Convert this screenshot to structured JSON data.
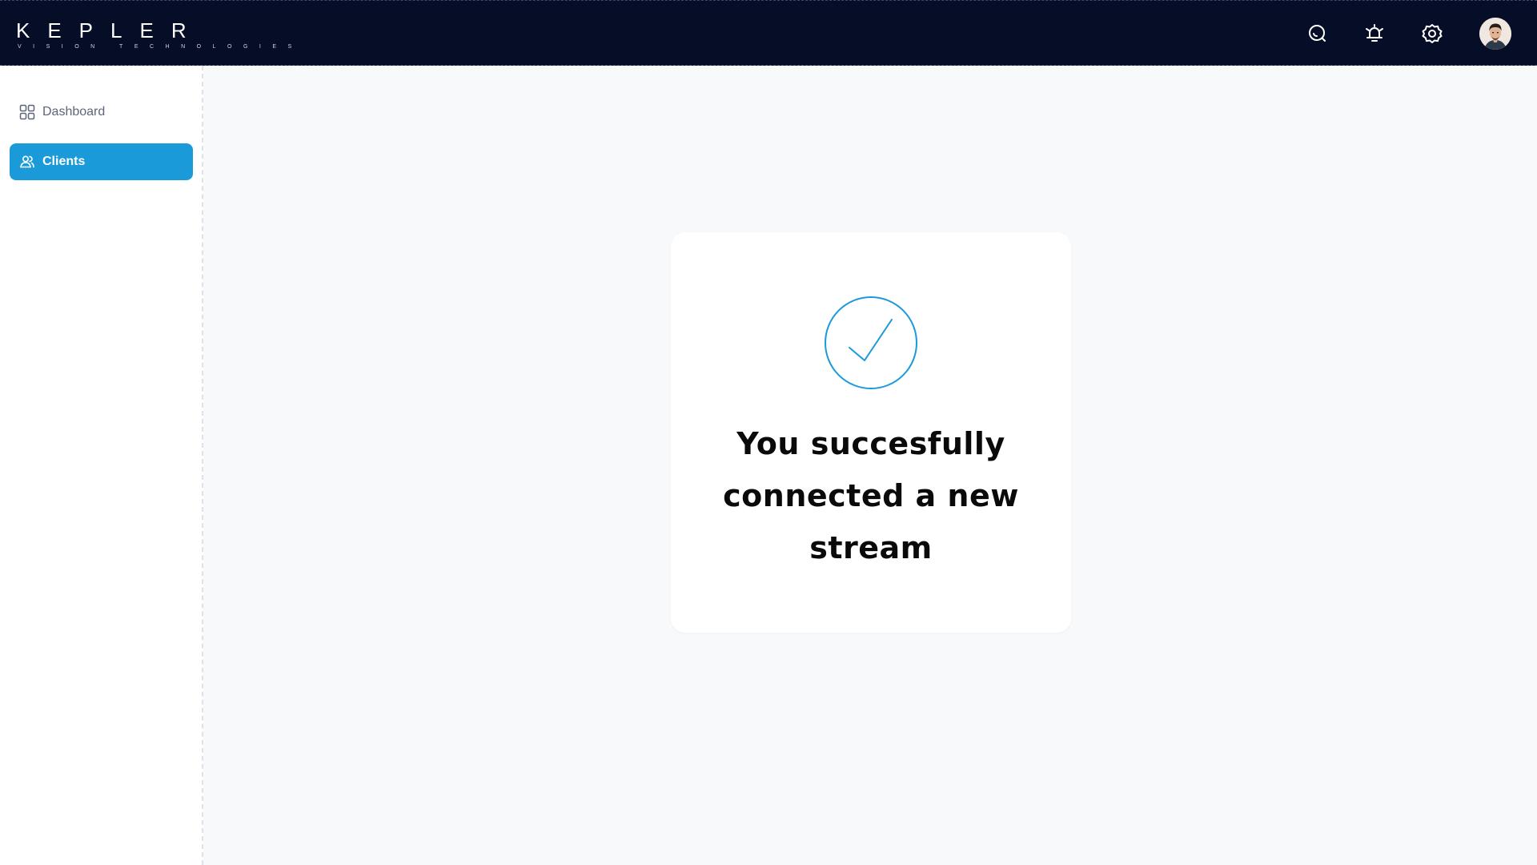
{
  "header": {
    "logo_text": "KEPLER",
    "logo_subtext": "VISION TECHNOLOGIES",
    "icons": [
      "search-icon",
      "alarm-bell-icon",
      "gear-icon",
      "user-avatar"
    ]
  },
  "sidebar": {
    "items": [
      {
        "label": "Dashboard",
        "icon": "grid-icon",
        "active": false
      },
      {
        "label": "Clients",
        "icon": "users-icon",
        "active": true
      }
    ]
  },
  "main": {
    "success_card": {
      "icon": "checkmark-circle-icon",
      "message": "You succesfully connected a new stream"
    }
  },
  "colors": {
    "topbar_bg": "#050e26",
    "accent": "#1b9ad9",
    "page_bg": "#f8f9fb"
  }
}
